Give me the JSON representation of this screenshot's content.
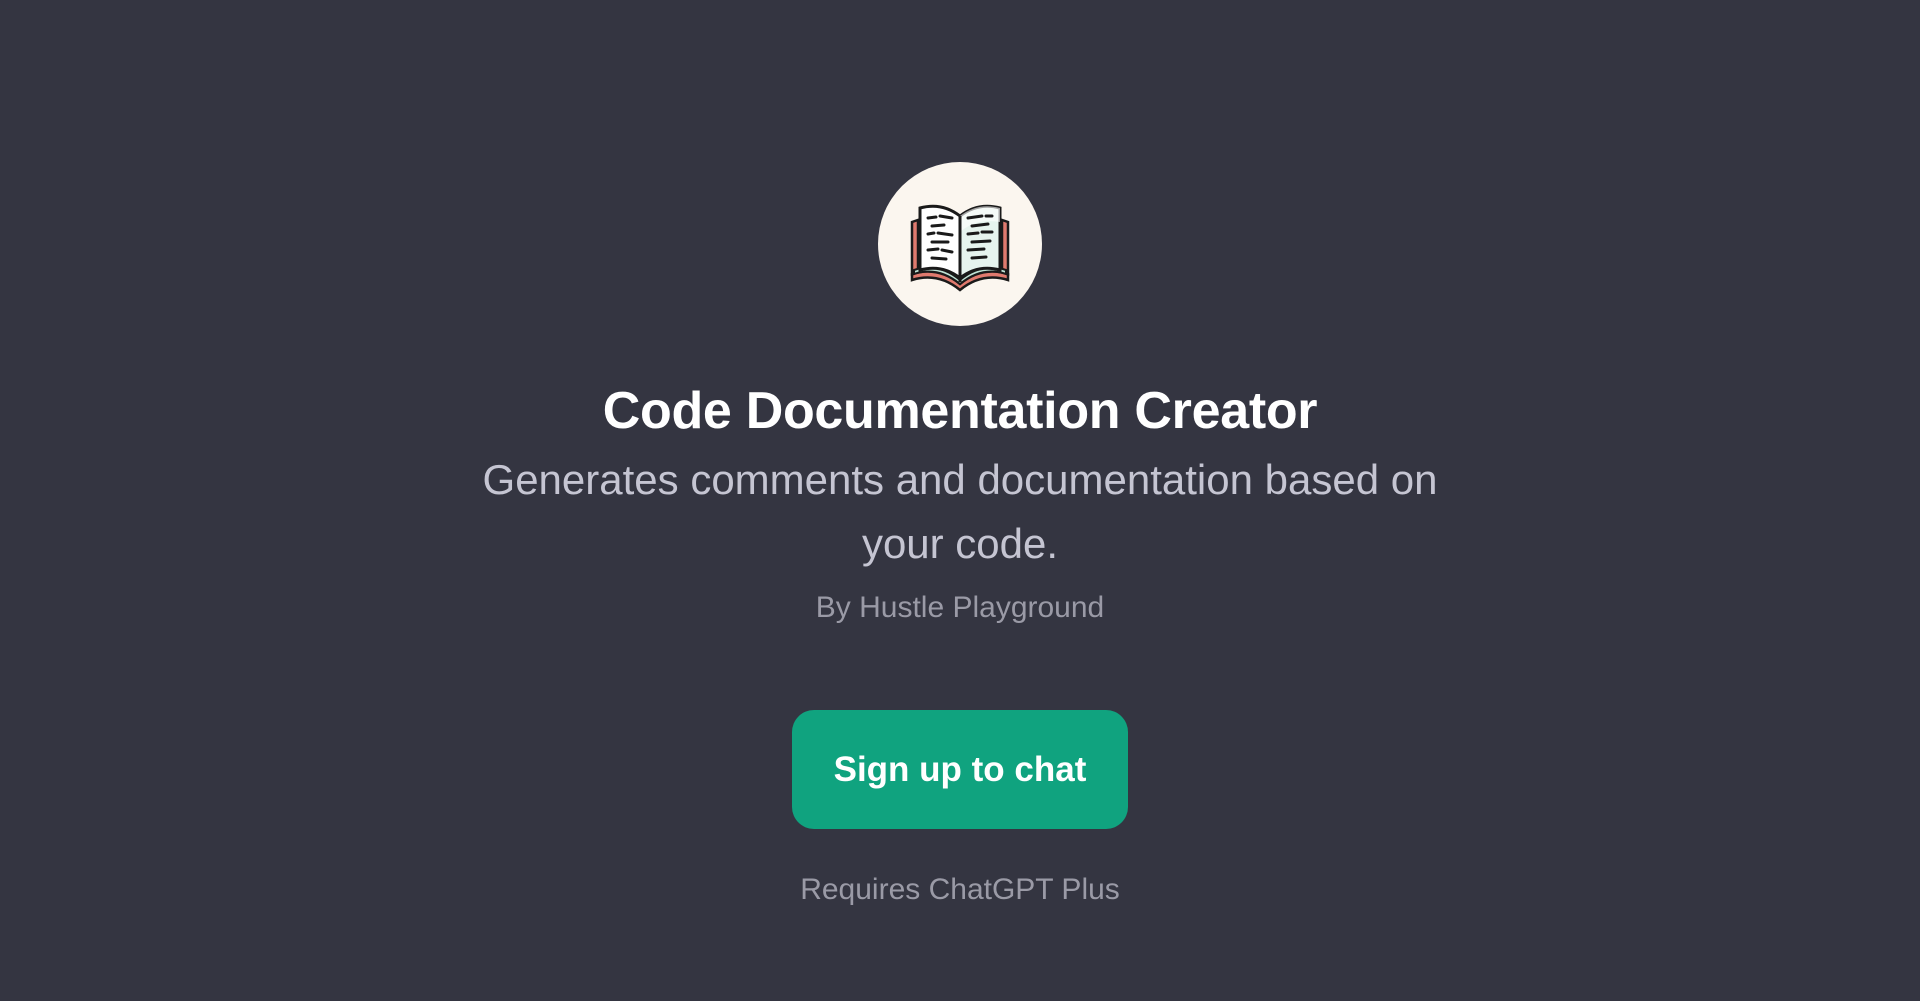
{
  "gpt": {
    "avatar_icon": "open-book-icon",
    "title": "Code Documentation Creator",
    "description": "Generates comments and documentation based on your code.",
    "author": "By Hustle Playground"
  },
  "cta": {
    "label": "Sign up to chat"
  },
  "footer": {
    "requirement": "Requires ChatGPT Plus"
  },
  "colors": {
    "background": "#343541",
    "button": "#10a37f",
    "avatar_bg": "#fbf6ef",
    "title": "#ffffff",
    "description": "#c5c5d2",
    "muted": "#9a9aa6"
  }
}
